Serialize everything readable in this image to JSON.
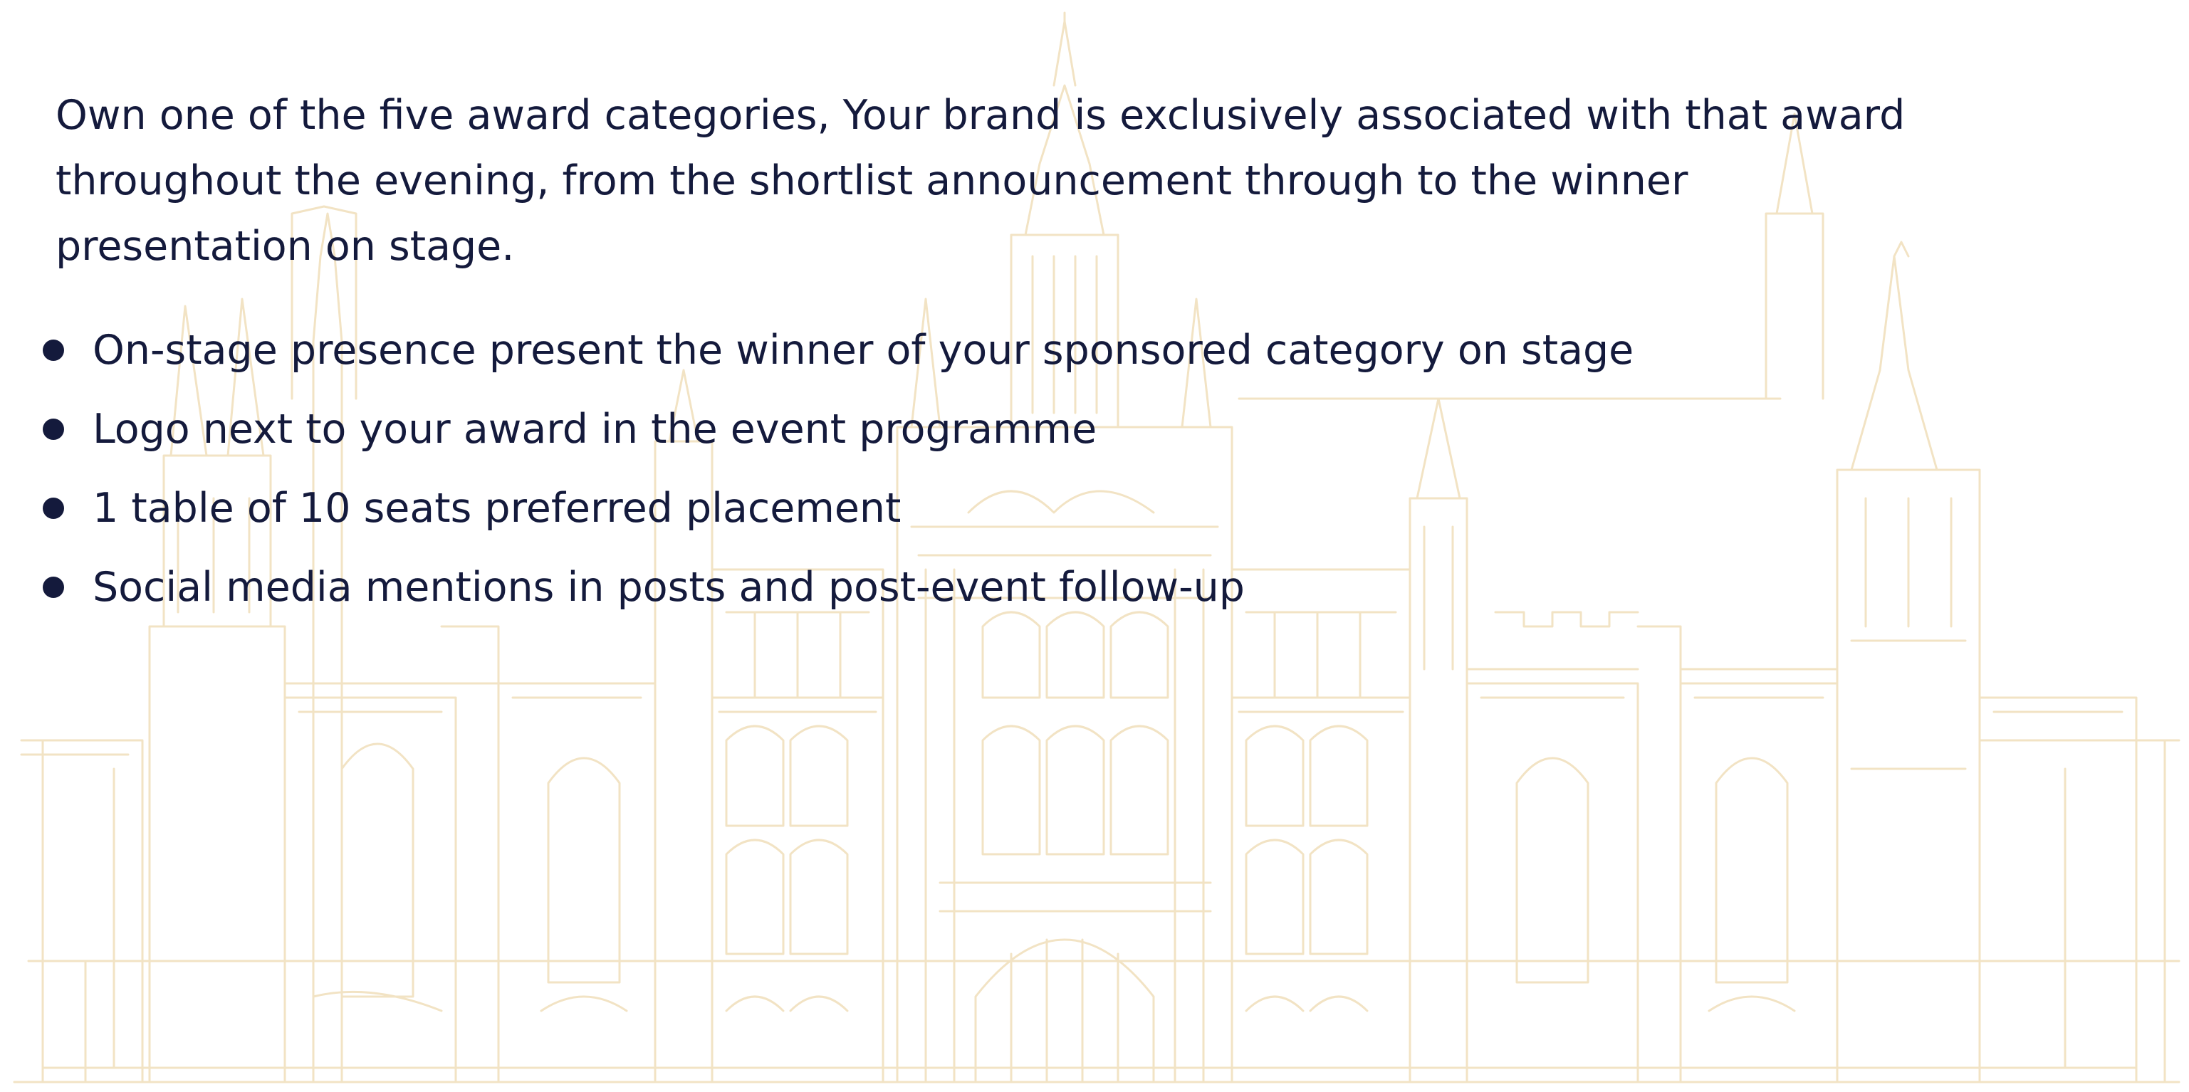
{
  "intro": {
    "text": "Own one of the five award categories, Your brand is exclusively associated with that award throughout the evening, from the shortlist announcement through to the winner presentation on stage."
  },
  "benefits": [
    {
      "text": "On-stage presence present the winner of your sponsored category on stage"
    },
    {
      "text": "Logo next to your award in the event programme"
    },
    {
      "text": "1 table of 10 seats preferred placement"
    },
    {
      "text": "Social media mentions in posts and post-event follow-up"
    }
  ],
  "colors": {
    "text": "#141a3c",
    "bullet": "#141a3c",
    "illustration_line": "#f2e3c4",
    "background": "#ffffff"
  },
  "decor": {
    "illustration": "gothic-building-line-drawing"
  }
}
